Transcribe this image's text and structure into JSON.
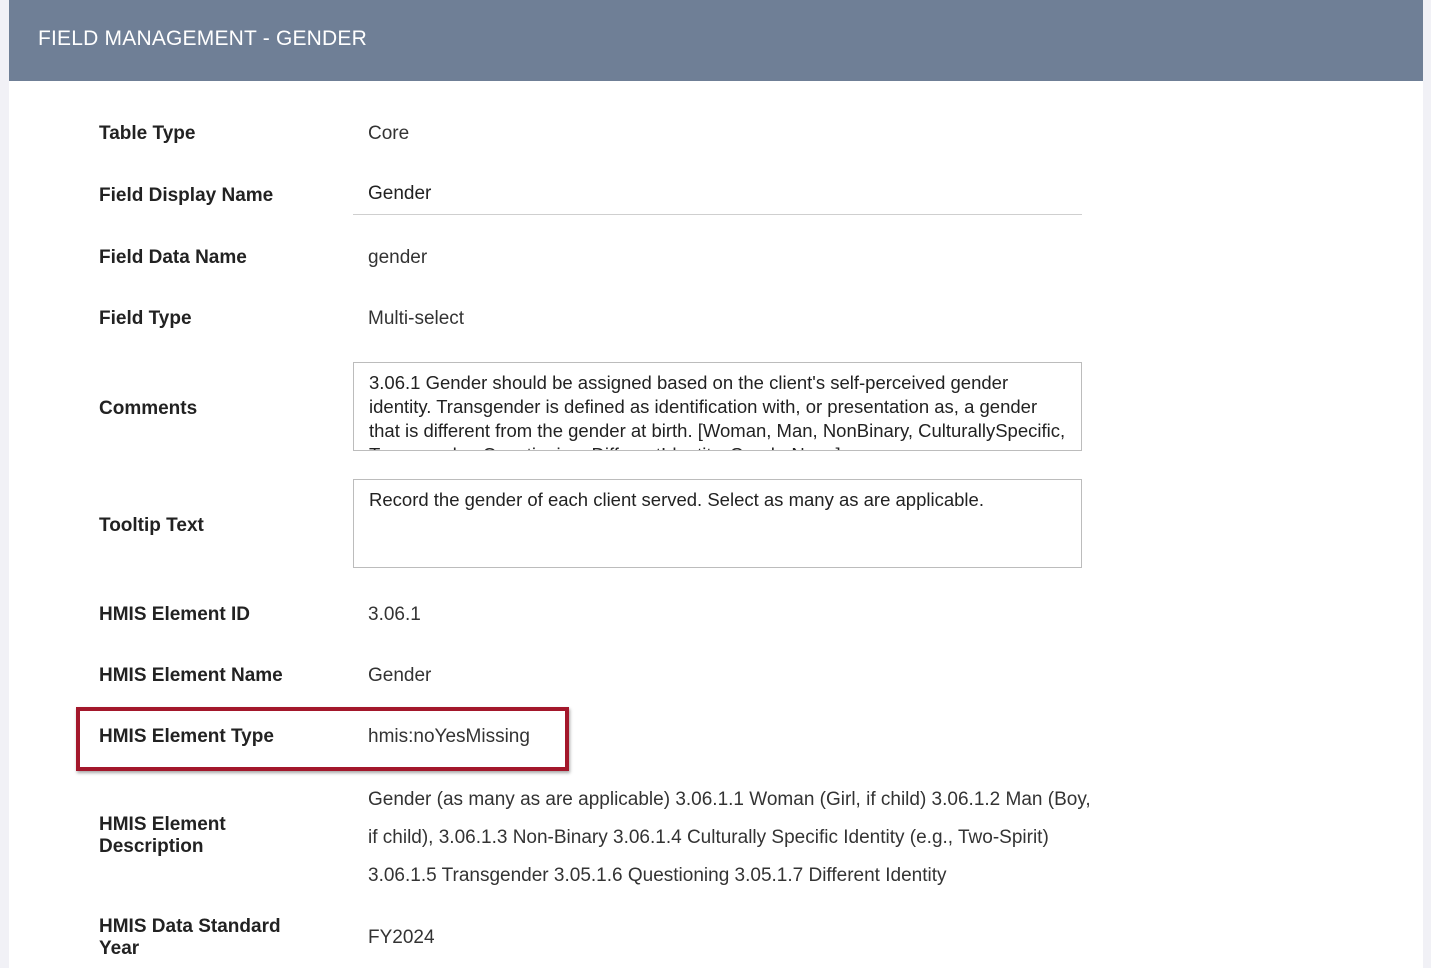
{
  "header": {
    "title": "FIELD MANAGEMENT - GENDER"
  },
  "fields": {
    "table_type": {
      "label": "Table Type",
      "value": "Core"
    },
    "field_display_name": {
      "label": "Field Display Name",
      "value": "Gender"
    },
    "field_data_name": {
      "label": "Field Data Name",
      "value": "gender"
    },
    "field_type": {
      "label": "Field Type",
      "value": "Multi-select"
    },
    "comments": {
      "label": "Comments",
      "value": "3.06.1 Gender should be assigned based on the client's self-perceived gender identity. Transgender is defined as identification with, or presentation as, a gender that is different from the gender at birth. [Woman, Man, NonBinary, CulturallySpecific, Transgender, Questioning, DifferentIdentity, GenderNone]"
    },
    "tooltip_text": {
      "label": "Tooltip Text",
      "value": "Record the gender of each client served. Select as many as are applicable."
    },
    "hmis_element_id": {
      "label": "HMIS Element ID",
      "value": "3.06.1"
    },
    "hmis_element_name": {
      "label": "HMIS Element Name",
      "value": "Gender"
    },
    "hmis_element_type": {
      "label": "HMIS Element Type",
      "value": "hmis:noYesMissing"
    },
    "hmis_element_description": {
      "label": "HMIS Element Description",
      "value": "Gender (as many as are applicable) 3.06.1.1 Woman (Girl, if child) 3.06.1.2 Man (Boy, if child), 3.06.1.3 Non-Binary 3.06.1.4 Culturally Specific Identity (e.g., Two-Spirit) 3.06.1.5 Transgender 3.05.1.6 Questioning 3.05.1.7 Different Identity"
    },
    "hmis_data_standard_year": {
      "label": "HMIS Data Standard Year",
      "value": "FY2024"
    }
  },
  "colors": {
    "header_bg": "#6f7f96",
    "highlight_border": "#a3172b",
    "page_bg": "#f1f1f6"
  }
}
